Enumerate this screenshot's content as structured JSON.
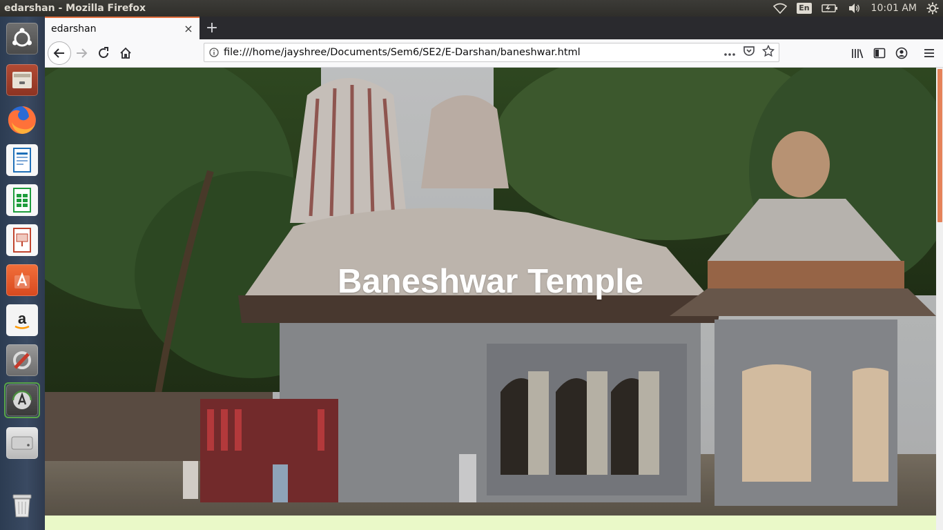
{
  "system": {
    "window_title": "edarshan - Mozilla Firefox",
    "keyboard_layout": "En",
    "clock": "10:01 AM",
    "icons": [
      "wifi-icon",
      "keyboard-icon",
      "battery-icon",
      "volume-icon",
      "settings-gear-icon"
    ]
  },
  "launcher": {
    "items": [
      {
        "name": "ubuntu-dash",
        "color": "#e95420"
      },
      {
        "name": "files",
        "color": "#c9604a"
      },
      {
        "name": "firefox",
        "color": "#ff7139"
      },
      {
        "name": "libreoffice-writer",
        "color": "#1e6fb8"
      },
      {
        "name": "libreoffice-calc",
        "color": "#1d9c3b"
      },
      {
        "name": "libreoffice-impress",
        "color": "#c0432c"
      },
      {
        "name": "ubuntu-software",
        "color": "#e85e2b"
      },
      {
        "name": "amazon",
        "color": "#f4f4f4"
      },
      {
        "name": "system-settings",
        "color": "#8a8a8a"
      },
      {
        "name": "software-updater",
        "color": "#4a8c3e"
      },
      {
        "name": "disk-drive",
        "color": "#d0d0d0"
      },
      {
        "name": "trash",
        "color": "#bdbdbd"
      }
    ]
  },
  "browser": {
    "tab": {
      "title": "edarshan",
      "close": "×"
    },
    "new_tab": "+",
    "url": "file:///home/jayshree/Documents/Sem6/SE2/E-Darshan/baneshwar.html",
    "accent": "#e36f3e"
  },
  "page": {
    "hero_title": "Baneshwar Temple",
    "background": "#eaf9c8"
  }
}
